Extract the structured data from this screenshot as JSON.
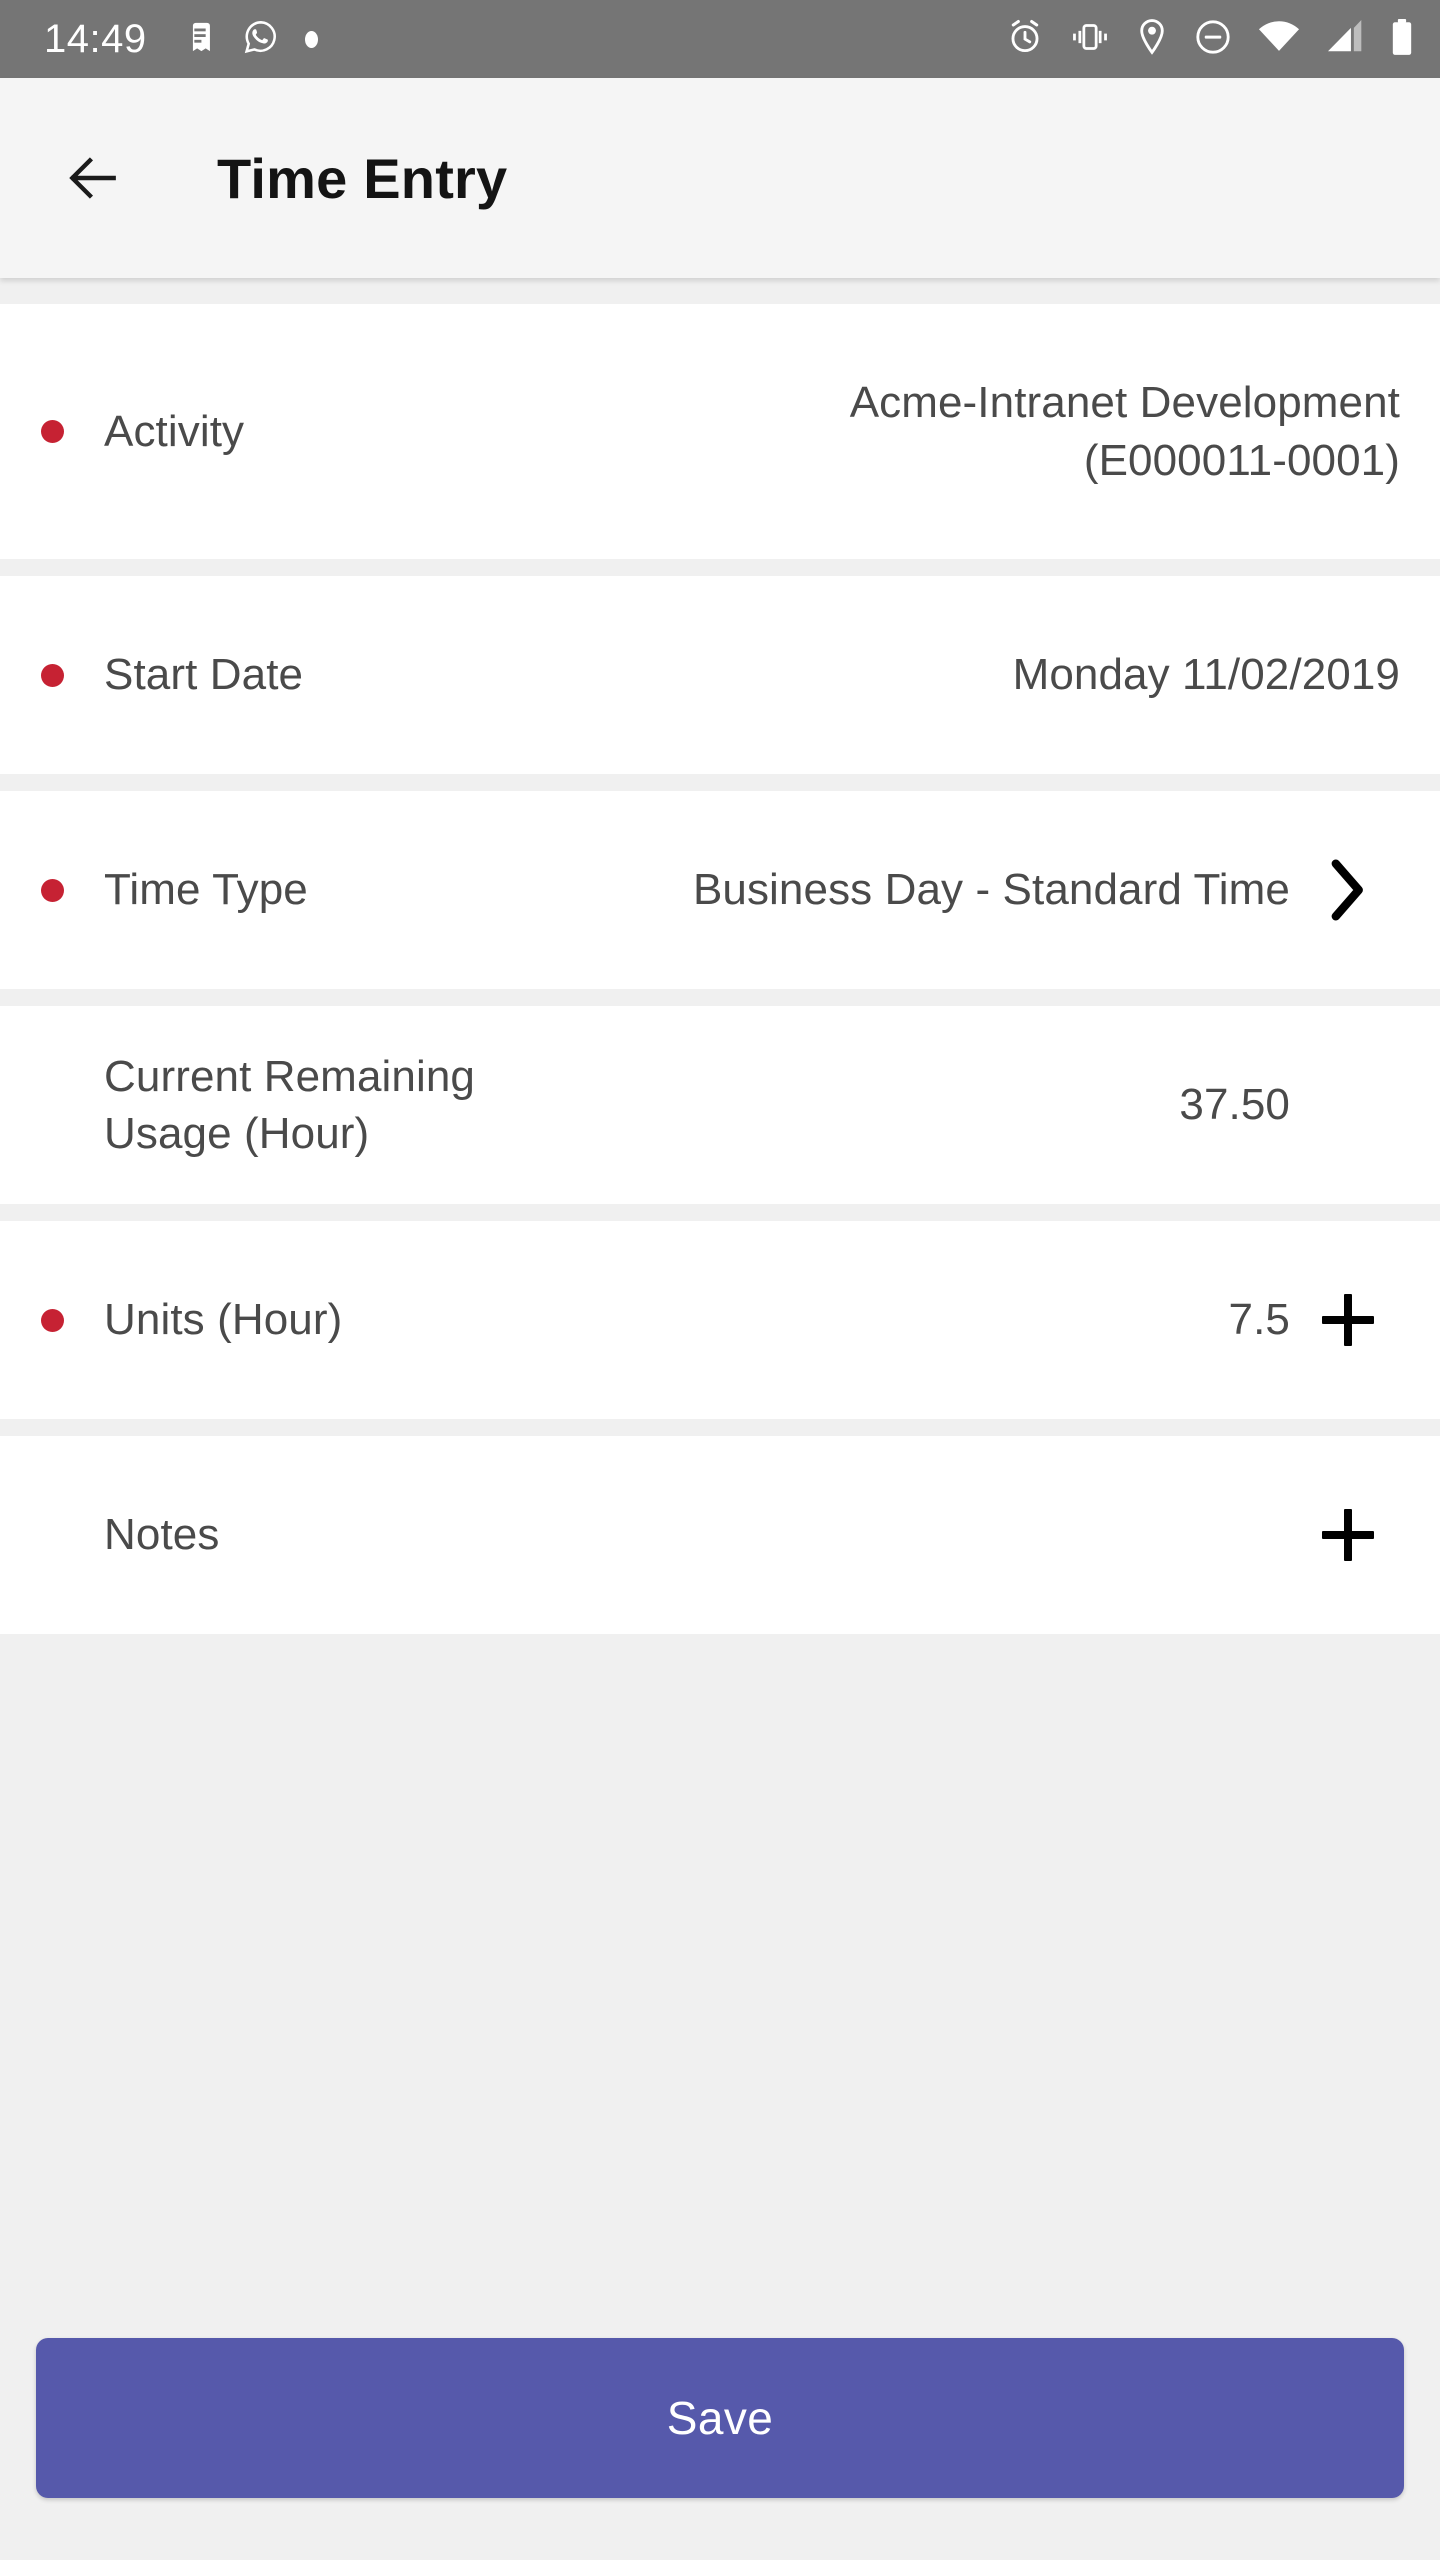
{
  "status_bar": {
    "time": "14:49",
    "left_icons": [
      "message-icon",
      "whatsapp-icon",
      "notification-dot-icon"
    ],
    "right_icons": [
      "alarm-clock-icon",
      "vibrate-icon",
      "location-pin-icon",
      "do-not-disturb-icon",
      "wifi-icon",
      "cellular-signal-icon",
      "battery-icon"
    ],
    "background_color": "#757575"
  },
  "app_bar": {
    "back_icon": "arrow-left-icon",
    "title": "Time Entry",
    "background_color": "#f5f5f5"
  },
  "form": {
    "required_dot_color": "#c62233",
    "rows": [
      {
        "key": "activity",
        "label": "Activity",
        "value": "Acme-Intranet Development (E000011-0001)",
        "required": true,
        "action_icon": ""
      },
      {
        "key": "start_date",
        "label": "Start Date",
        "value": "Monday 11/02/2019",
        "required": true,
        "action_icon": ""
      },
      {
        "key": "time_type",
        "label": "Time Type",
        "value": "Business Day - Standard Time",
        "required": true,
        "action_icon": "chevron-right-icon"
      },
      {
        "key": "current_remaining_usage",
        "label": "Current Remaining Usage (Hour)",
        "value": "37.50",
        "required": false,
        "action_icon": ""
      },
      {
        "key": "units",
        "label": "Units (Hour)",
        "value": "7.5",
        "required": true,
        "action_icon": "plus-icon"
      },
      {
        "key": "notes",
        "label": "Notes",
        "value": "",
        "required": false,
        "action_icon": "plus-icon"
      }
    ]
  },
  "footer": {
    "save_label": "Save",
    "save_color": "#5659ab"
  }
}
